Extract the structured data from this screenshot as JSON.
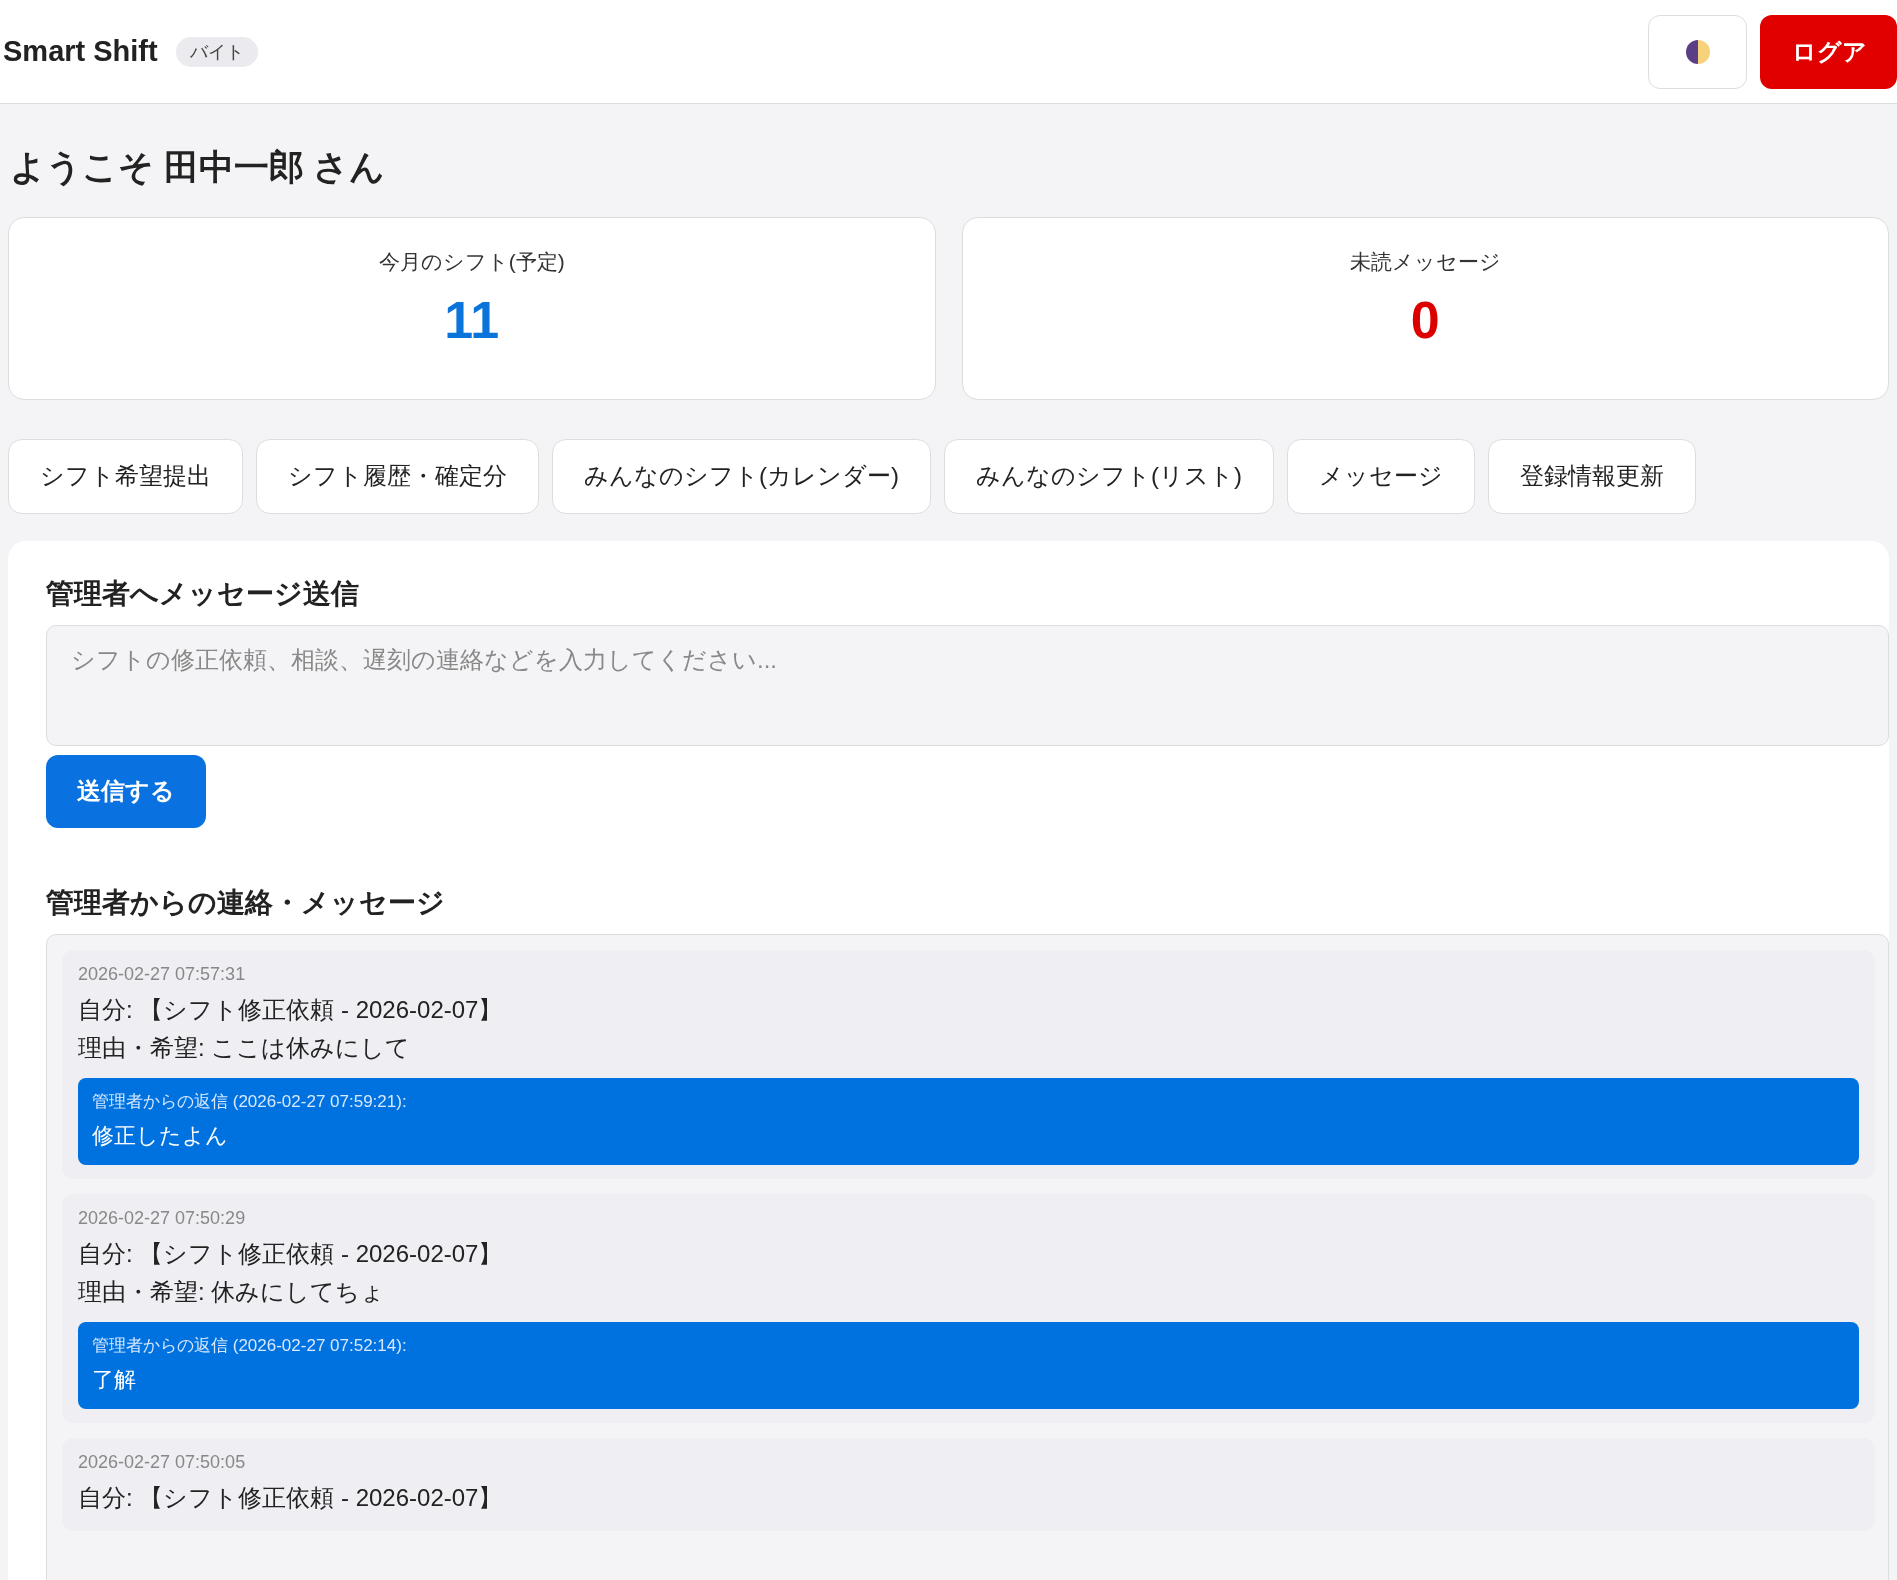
{
  "header": {
    "title": "Smart Shift",
    "role_badge": "バイト",
    "logout_button": "ログア"
  },
  "welcome": "ようこそ 田中一郎 さん",
  "stats": [
    {
      "label": "今月のシフト(予定)",
      "value": "11",
      "color": "#0a74da"
    },
    {
      "label": "未読メッセージ",
      "value": "0",
      "color": "#dd0000"
    }
  ],
  "nav": [
    "シフト希望提出",
    "シフト履歴・確定分",
    "みんなのシフト(カレンダー)",
    "みんなのシフト(リスト)",
    "メッセージ",
    "登録情報更新"
  ],
  "compose": {
    "title": "管理者へメッセージ送信",
    "placeholder": "シフトの修正依頼、相談、遅刻の連絡などを入力してください...",
    "send_button": "送信する"
  },
  "inbox": {
    "title": "管理者からの連絡・メッセージ",
    "messages": [
      {
        "timestamp": "2026-02-27 07:57:31",
        "lines": [
          "自分: 【シフト修正依頼 - 2026-02-07】",
          "理由・希望: ここは休みにして"
        ],
        "reply": {
          "label": "管理者からの返信 (2026-02-27 07:59:21):",
          "text": "修正したよん"
        }
      },
      {
        "timestamp": "2026-02-27 07:50:29",
        "lines": [
          "自分: 【シフト修正依頼 - 2026-02-07】",
          "理由・希望: 休みにしてちょ"
        ],
        "reply": {
          "label": "管理者からの返信 (2026-02-27 07:52:14):",
          "text": "了解"
        }
      },
      {
        "timestamp": "2026-02-27 07:50:05",
        "lines": [
          "自分: 【シフト修正依頼 - 2026-02-07】"
        ]
      }
    ]
  }
}
